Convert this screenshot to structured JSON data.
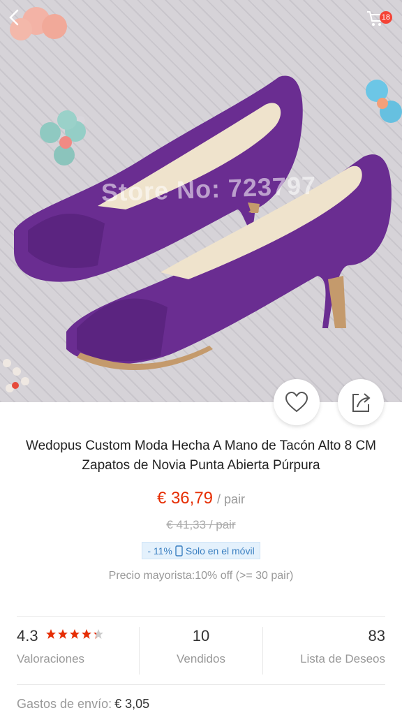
{
  "header": {
    "cart_count": "18"
  },
  "product": {
    "watermark": "Store No: 723797",
    "title": "Wedopus Custom Moda Hecha A Mano de Tacón Alto 8 CM Zapatos de Novia Punta Abierta Púrpura",
    "price": "€ 36,79",
    "unit": "/ pair",
    "old_price": "€ 41,33  / pair",
    "discount": "- 11%",
    "mobile_only": "Solo en el móvil",
    "wholesale": "Precio mayorista:10% off (>= 30 pair)"
  },
  "stats": {
    "rating": "4.3",
    "rating_stars": 4.3,
    "rating_label": "Valoraciones",
    "sold": "10",
    "sold_label": "Vendidos",
    "wishlist": "83",
    "wishlist_label": "Lista de Deseos"
  },
  "shipping": {
    "label": "Gastos de envío:",
    "value": "€ 3,05"
  },
  "colors": {
    "accent": "#e62e04",
    "badge": "#f44336",
    "shoe": "#6a2d91"
  },
  "icons": [
    "back-arrow-icon",
    "cart-icon",
    "heart-icon",
    "share-icon",
    "star-icon",
    "phone-icon"
  ]
}
